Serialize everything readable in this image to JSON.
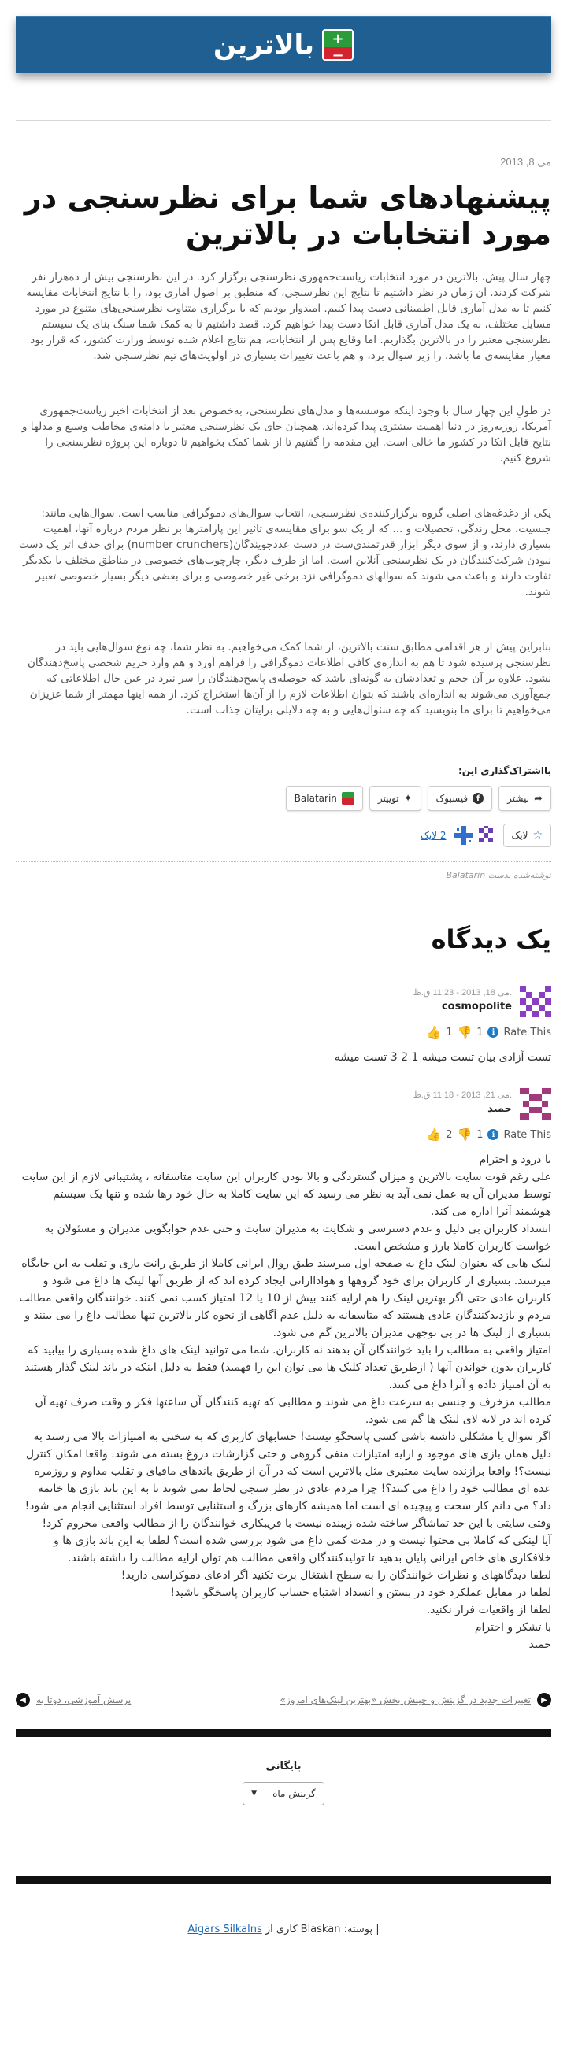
{
  "site": {
    "title": "بالاترین",
    "logo_plus": "+",
    "logo_minus": "−"
  },
  "post": {
    "date": "می 8, 2013",
    "title": "پیشنهادهای شما برای نظرسنجی در مورد انتخابات در بالاترین",
    "paragraphs": [
      "چهار سال پیش، بالاترین در مورد انتخابات ریاست‌جمهوری نظرسنجی برگزار کرد. در این نظرسنجی  بیش از ده‌هزار نفر شرکت کردند.  آن زمان در نظر داشتیم تا نتایج این نظرسنجی، که منطبق بر اصول آماری بود، را با نتایج انتخابات مقایسه کنیم تا به مدل آماری قابل اطمینانی دست پیدا کنیم.  امیدوار بودیم  که با برگزاری متناوب نظرسنجی‌های متنوع در مورد مسایل مختلف، به یک مدل آماری قابل اتکا دست پیدا خواهیم کرد.  قصد داشتیم تا به کمک شما سنگ بنای یک سیستم نظرسنجی معتبر را در بالاترین بگذاریم. اما وقایع پس از انتخابات، هم نتایج اعلام شده توسط وزارت کشور، که قرار بود معیار مقایسه‌ی ما باشد، را زیر سوال برد، و هم باعث تغییرات بسیاری در اولویت‌های تیم نظرسنجی شد.",
      "در طولِ این چهار سال با وجود اینکه موسسه‌ها و مدل‌های نظرسنجی، به‌خصوص بعد از انتخابات اخیر ریاست‌جمهوری آمریکا، روز‌به‌روز در دنیا اهمیت بیشتری پیدا کرده‌اند، همچنان جای یک نظرسنجی معتبر با دامنه‌ی مخاطب وسیع و مدلها و نتایج قابل اتکا در کشور ما خالی است. این مقدمه را گفتیم تا از شما کمک بخواهیم تا دوباره این پروژه نظرسنجی را شروع کنیم.",
      "یکی از دغدغه‌های اصلی گروه برگزارکننده‌ی نظرسنجی، انتخاب سوال‌های دموگرافی مناسب است. سوال‌هایی مانند: جنسیت، محل زندگی، تحصیلات و ... که از یک سو برای مقایسه‌ی تاثیر این پارامترها بر نظر مردم درباره آنها، اهمیت بسیاری دارند، و از سوی دیگر ابزار قدرتمندی‌ست در دست عدد‌جویندگان(number crunchers) برای حذف اثر یک دست نبودن شرکت‌کنندگان در یک نظرسنجی آنلاین است. اما از طرف دیگر، چارچوب‌های خصوصی در مناطق مختلف با یکدیگر تفاوت دارند و باعث می شوند که سوالهای دموگرافی نزد برخی غیر خصوصی و برای بعضی دیگر بسیار خصوصی تعبیر شوند.",
      "بنابراین پیش از هر اقدامی مطابق سنت بالاترین، از شما کمک می‌خواهیم. به نظر شما، چه نوع سوال‌هایی باید در نظرسنجی پرسیده شود تا هم به اندازه‌ی کافی اطلاعات دموگرافی را فراهم آورد  و هم وارد حریم شخصی پاسخ‌دهندگان نشود. علاوه بر آن حجم و تعدادشان به گونه‌ای باشد که حوصله‌ی پاسخ‌دهندگان را سر نبرد در عین حال اطلاعاتی که جمع‌آوری می‌شوند به اندازه‌ای باشند که بتوان  اطلاعات لازم را از آن‌ها استخراج کرد. از همه اینها مهمتر از شما عزیزان می‌خواهیم تا برای ما بنویسید که چه سئوال‌هایی و به چه دلایلی برایتان جذاب است."
    ]
  },
  "share": {
    "label": "بااشتراک‌گذاری این:",
    "buttons": [
      "بیشتر",
      "فیسبوک",
      "توییتر",
      "Balatarin"
    ],
    "like_label": "لایک",
    "like_count": "2 لایک"
  },
  "posted_by": {
    "prefix": "نوشته‌شده بدست",
    "author": "Balatarin"
  },
  "comments_section": {
    "title": "یک دیدگاه",
    "comments": [
      {
        "date": "می 18, 2013 - 11:23 ق.ظ.",
        "author": "cosmopolite",
        "rate_label": "Rate This",
        "down": "1",
        "up": "1",
        "body": [
          "تست آزادی بیان تست میشه 1 2 3 تست میشه"
        ]
      },
      {
        "date": "می 21, 2013 - 11:18 ق.ظ.",
        "author": "حمید",
        "rate_label": "Rate This",
        "down": "1",
        "up": "2",
        "body": [
          "با درود و احترام",
          "علی رغم فوت سایت بالاترین و میزان گستردگی و بالا بودن کاربران این سایت متاسفانه ، پشتیبانی لازم از این سایت توسط مدیران آن به عمل نمی آید به نظر می رسید که این سایت کاملا به حال خود رها شده و تنها یک سیستم هوشمند آنرا اداره می کند.",
          "انسداد کاربران بی دلیل و عدم دسترسی و شکایت به مدیران سایت و حتی عدم جوابگویی مدیران و مسئولان به خواست کاربران کاملا بارز و مشخص است.",
          "لینک هایی که بعنوان لینک داغ به صفحه اول میرسند طبق روال ایرانی کاملا از طریق رانت بازی و تقلب به این جایگاه میرسند. بسیاری از کاربران برای خود گروهها و هواداارانی ایجاد کرده اند که از طریق آنها لینک ها داغ می شود و کاربران عادی حتی اگر بهترین لینک را هم ارایه کنند بیش از 10 یا 12 امتیاز کسب نمی کنند. خوانندگان واقعی مطالب مردم و بازدیدکنندگان عادی هستند که متاسفانه به دلیل عدم آگاهی از نحوه کار بالاترین تنها مطالب داغ را می بینند و بسیاری از لینک ها در بی توجهی مدیران بالاترین گم می شود.",
          "امتیاز واقعی به مطالب را باید خوانندگان آن بدهند نه کاربران. شما می توانید لینک های داغ شده بسیاری را بیابید که کاربران بدون خواندن آنها ( ازطریق تعداد کلیک ها می توان این را فهمید) فقط به دلیل اینکه در باند لینک گذار هستند به آن امتیاز داده و آنرا داغ می کنند.",
          "مطالب مزخرف و جنسی به سرعت داغ می شوند و مطالبی که تهیه کنندگان آن ساعتها فکر و وقت صرف تهیه آن کرده اند در لابه لای لینک ها گم می شود.",
          "اگر سوال یا مشکلی داشته باشی کسی پاسخگو نیست! حسابهای کاربری که به سخنی به امتیازات بالا می رسند به دلیل همان بازی های موجود و ارایه امتیازات منفی گروهی و حتی گزارشات دروغ بسته می شوند. واقعا امکان کنترل نیست؟! واقعا برازنده سایت معتبری مثل بالاترین است که در آن از طریق باندهای مافیای و تقلب مداوم و روزمره عده ای مطالب خود را داغ می کنند؟! چرا مردم عادی در نظر سنجی لحاظ نمی شوند تا به این باند بازی ها خاتمه داد؟ می دانم کار سخت و پیچیده ای است اما همیشه کارهای بزرگ و استثنایی توسط افراد استثنایی انجام می شود! وقتی سایتی با این حد تماشاگر ساخته شده زیبنده نیست با فریبکاری خوانندگان را از مطالب واقعی محروم کرد!",
          "آیا لینکی که کاملا بی محتوا نیست و در مدت کمی داغ می شود بررسی شده است؟ لطفا به این باند بازی ها و خلافکاری های خاص ایرانی پایان بدهید تا تولیدکنندگان واقعی مطالب هم توان ارایه مطالب را داشته باشند.",
          "لطفا دیدگاههای و نظرات خوانندگان را به سطح اشتغال برت تکنید اگر ادعای دموکراسی دارید!",
          "لطفا در مقابل عملکرد خود در بستن و انسداد اشتباه حساب کاربران پاسخگو باشید!",
          "لطفا از واقعیات فرار نکنید.",
          "با تشکر و احترام",
          "حمید"
        ]
      }
    ]
  },
  "post_nav": {
    "prev": "تغییرات جدید در گزینش و چینش بخش «بهترین لینک‌های امروز»",
    "next": "پرسش آموزشی، دوتا به"
  },
  "archive": {
    "title": "بایگانی",
    "select": "گزینش ماه"
  },
  "footer": {
    "text_before": "| پوسته: Blaskan کاری از",
    "link": "Aigars Silkalns"
  },
  "colors": {
    "header_bg": "#1f5f91",
    "logo_green": "#2a9d3a",
    "logo_red": "#d3232e",
    "link": "#1a66b3"
  }
}
